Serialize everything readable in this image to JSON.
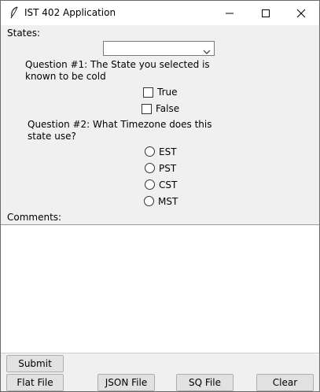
{
  "window": {
    "title": "IST 402 Application",
    "icon": "feather-icon",
    "controls": [
      "minimize-icon",
      "maximize-icon",
      "close-icon"
    ]
  },
  "form": {
    "states_label": "States:",
    "state_select": {
      "value": ""
    },
    "question1": {
      "text": "Question #1: The State you selected is known to be cold",
      "options": [
        {
          "label": "True",
          "checked": false
        },
        {
          "label": "False",
          "checked": false
        }
      ]
    },
    "question2": {
      "text": "Question #2: What Timezone does this state use?",
      "options": [
        {
          "label": "EST",
          "selected": false
        },
        {
          "label": "PST",
          "selected": false
        },
        {
          "label": "CST",
          "selected": false
        },
        {
          "label": "MST",
          "selected": false
        }
      ]
    },
    "comments_label": "Comments:",
    "comments_value": ""
  },
  "buttons": {
    "submit": "Submit",
    "flat_file": "Flat File",
    "json_file": "JSON File",
    "sq_file": "SQ File",
    "clear": "Clear"
  },
  "colors": {
    "window_bg": "#f0f0f0",
    "titlebar_bg": "#ffffff",
    "desktop_bg": "#1e1e1e"
  }
}
